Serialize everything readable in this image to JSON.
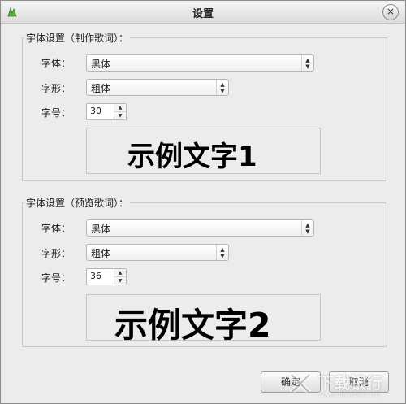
{
  "window": {
    "title": "设置",
    "close": "×"
  },
  "groups": [
    {
      "title": "字体设置（制作歌词）：",
      "font_label": "字体：",
      "font_value": "黑体",
      "style_label": "字形：",
      "style_value": "粗体",
      "size_label": "字号：",
      "size_value": "30",
      "preview_text": "示例文字1"
    },
    {
      "title": "字体设置（预览歌词）：",
      "font_label": "字体：",
      "font_value": "黑体",
      "style_label": "字形：",
      "style_value": "粗体",
      "size_label": "字号：",
      "size_value": "36",
      "preview_text": "示例文字2"
    }
  ],
  "buttons": {
    "ok": "确定",
    "cancel": "取消"
  },
  "watermark": {
    "text": "下载银行",
    "sub": "www.downbank.cn"
  },
  "icons": {
    "app": "app-logo-icon",
    "close": "close-icon"
  }
}
